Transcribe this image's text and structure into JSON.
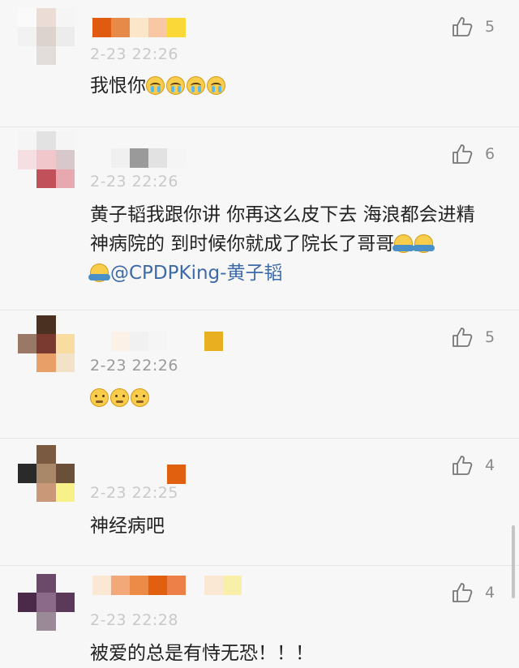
{
  "comments": [
    {
      "timestamp": "2-23 22:26",
      "text": "我恨你",
      "emoji_icons": [
        "crying-icon",
        "crying-icon",
        "crying-icon",
        "crying-icon"
      ],
      "likes": "5"
    },
    {
      "timestamp": "2-23 22:26",
      "text": "黄子韬我跟你讲 你再这么皮下去 海浪都会进精神病院的 到时候你就成了院长了哥哥",
      "mention": "@CPDPKing-黄子韬",
      "emoji_icons": [
        "hug-icon",
        "hug-icon",
        "hug-icon"
      ],
      "likes": "6"
    },
    {
      "timestamp": "2-23 22:26",
      "text": "",
      "emoji_icons": [
        "thinking-icon",
        "thinking-icon",
        "thinking-icon"
      ],
      "likes": "5"
    },
    {
      "timestamp": "2-23 22:25",
      "text": "神经病吧",
      "emoji_icons": [],
      "likes": "4"
    },
    {
      "timestamp": "2-23 22:28",
      "text": "被爱的总是有恃无恐！！！",
      "emoji_icons": [],
      "likes": "4"
    }
  ],
  "icons": {
    "like": "thumbs-up-icon"
  },
  "colors": {
    "mention": "#3d6aa8",
    "timestamp": "#9a9a9a",
    "like_icon": "#777777"
  }
}
